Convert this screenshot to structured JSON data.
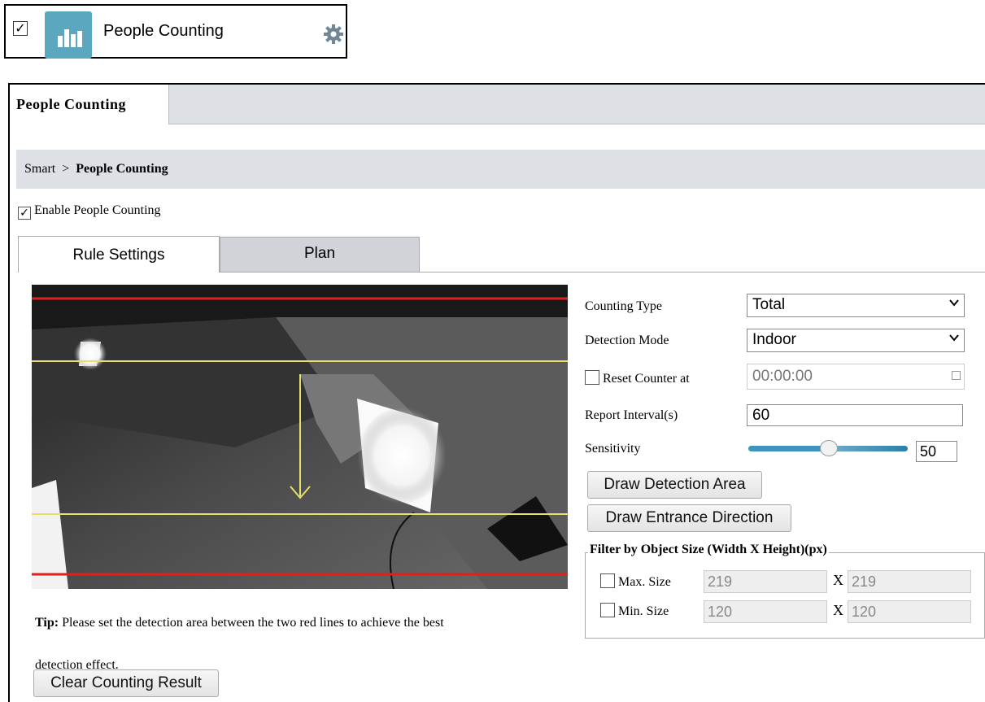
{
  "app_card": {
    "checked": true,
    "label": "People Counting",
    "icon": "bar-chart-icon",
    "settings_icon": "gear-icon",
    "icon_color": "#5aa7bf"
  },
  "page": {
    "tab_title": "People Counting",
    "breadcrumb_root": "Smart",
    "breadcrumb_sep": ">",
    "breadcrumb_current": "People Counting",
    "enable_label": "Enable People Counting",
    "enable_checked": true
  },
  "tabs": [
    {
      "label": "Rule Settings",
      "active": true
    },
    {
      "label": "Plan",
      "active": false
    }
  ],
  "video": {
    "red_line_color": "#e0201f",
    "yellow_line_color": "#e8e06a"
  },
  "tip": {
    "label": "Tip:",
    "text": "Please set the detection area between the two red lines to achieve the best",
    "text2": "detection effect."
  },
  "clear_button": "Clear Counting Result",
  "settings": {
    "counting_type_label": "Counting Type",
    "counting_type_value": "Total",
    "detection_mode_label": "Detection Mode",
    "detection_mode_value": "Indoor",
    "reset_counter_label": "Reset Counter at",
    "reset_counter_checked": false,
    "reset_counter_value": "00:00:00",
    "report_interval_label": "Report Interval(s)",
    "report_interval_value": "60",
    "sensitivity_label": "Sensitivity",
    "sensitivity_value": "50",
    "sensitivity_fraction": 0.5,
    "draw_area_button": "Draw Detection Area",
    "draw_direction_button": "Draw Entrance Direction"
  },
  "filter": {
    "legend": "Filter by Object Size (Width X Height)(px)",
    "separator": "X",
    "max_label": "Max. Size",
    "max_checked": false,
    "max_width": "219",
    "max_height": "219",
    "min_label": "Min. Size",
    "min_checked": false,
    "min_width": "120",
    "min_height": "120"
  }
}
